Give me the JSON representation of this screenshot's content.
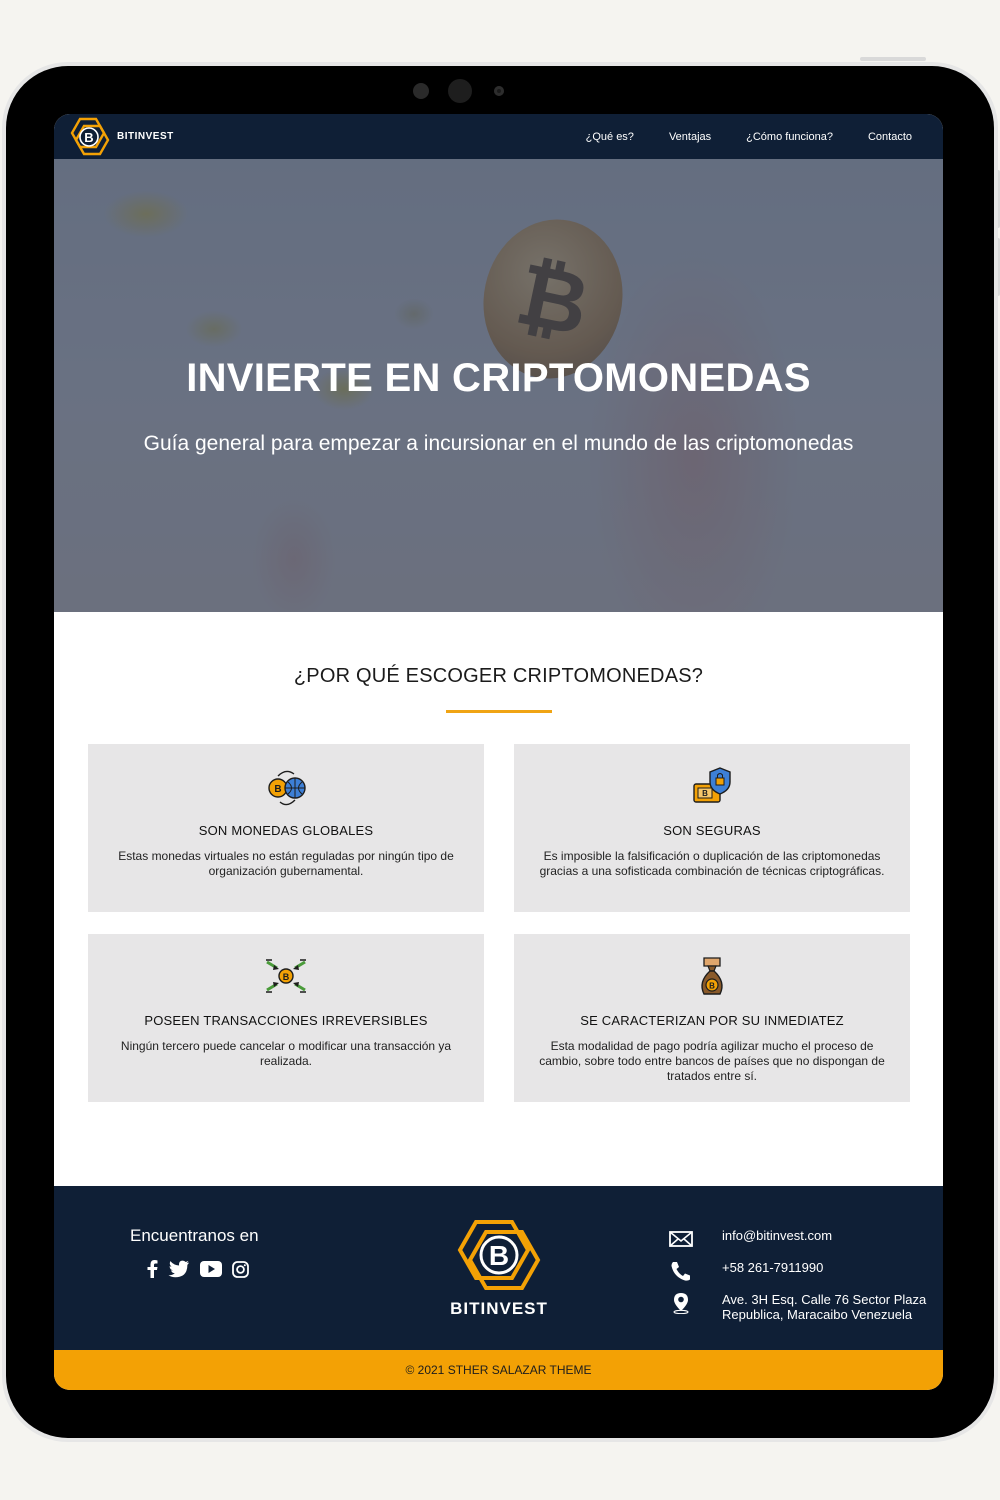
{
  "nav": {
    "brand": "BITINVEST",
    "links": [
      "¿Qué es?",
      "Ventajas",
      "¿Cómo funciona?",
      "Contacto"
    ]
  },
  "hero": {
    "title": "INVIERTE EN CRIPTOMONEDAS",
    "subtitle": "Guía general para empezar a incursionar en el mundo de las criptomonedas"
  },
  "why": {
    "title": "¿POR QUÉ ESCOGER CRIPTOMONEDAS?",
    "cards": [
      {
        "icon": "bitcoin-globe-icon",
        "title": "SON MONEDAS GLOBALES",
        "desc": "Estas monedas virtuales no están reguladas por ningún tipo de organización gubernamental."
      },
      {
        "icon": "bitcoin-wallet-shield-icon",
        "title": "SON SEGURAS",
        "desc": "Es imposible la falsificación o duplicación de las criptomonedas gracias a una sofisticada combinación de técnicas criptográficas."
      },
      {
        "icon": "bitcoin-arrows-icon",
        "title": "POSEEN TRANSACCIONES IRREVERSIBLES",
        "desc": "Ningún tercero puede cancelar o modificar una transacción ya realizada."
      },
      {
        "icon": "bitcoin-money-bag-icon",
        "title": "SE CARACTERIZAN POR SU INMEDIATEZ",
        "desc": "Esta modalidad de pago podría agilizar mucho el proceso de cambio, sobre todo entre bancos de países que no dispongan de tratados entre sí."
      }
    ]
  },
  "footer": {
    "find_us": "Encuentranos en",
    "brand": "BITINVEST",
    "email": "info@bitinvest.com",
    "phone": "+58 261-7911990",
    "address_line1": "Ave. 3H Esq. Calle 76 Sector Plaza",
    "address_line2": "Republica, Maracaibo Venezuela",
    "copyright": "© 2021 STHER SALAZAR THEME"
  },
  "colors": {
    "navy": "#0f1f36",
    "accent": "#f3a105",
    "card_bg": "#e7e6e7"
  }
}
